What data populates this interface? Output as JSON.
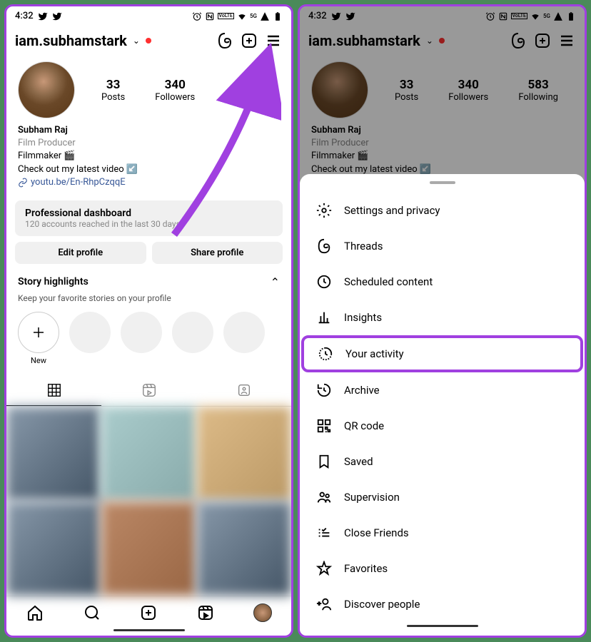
{
  "status": {
    "time": "4:32"
  },
  "header": {
    "username": "iam.subhamstark"
  },
  "stats": {
    "posts": {
      "count": "33",
      "label": "Posts"
    },
    "followers": {
      "count": "340",
      "label": "Followers"
    },
    "following": {
      "count": "583",
      "label": "Following"
    }
  },
  "bio": {
    "name": "Subham Raj",
    "category": "Film Producer",
    "line1": "Filmmaker 🎬",
    "line2": "Check out my latest video ↙️",
    "link": "youtu.be/En-RhpCzqqE"
  },
  "dashboard": {
    "title": "Professional dashboard",
    "subtitle": "120 accounts reached in the last 30 days."
  },
  "buttons": {
    "edit": "Edit profile",
    "share": "Share profile"
  },
  "highlights": {
    "title": "Story highlights",
    "subtitle": "Keep your favorite stories on your profile",
    "new_label": "New"
  },
  "menu": {
    "settings": "Settings and privacy",
    "threads": "Threads",
    "scheduled": "Scheduled content",
    "insights": "Insights",
    "activity": "Your activity",
    "archive": "Archive",
    "qr": "QR code",
    "saved": "Saved",
    "supervision": "Supervision",
    "close_friends": "Close Friends",
    "favorites": "Favorites",
    "discover": "Discover people"
  }
}
